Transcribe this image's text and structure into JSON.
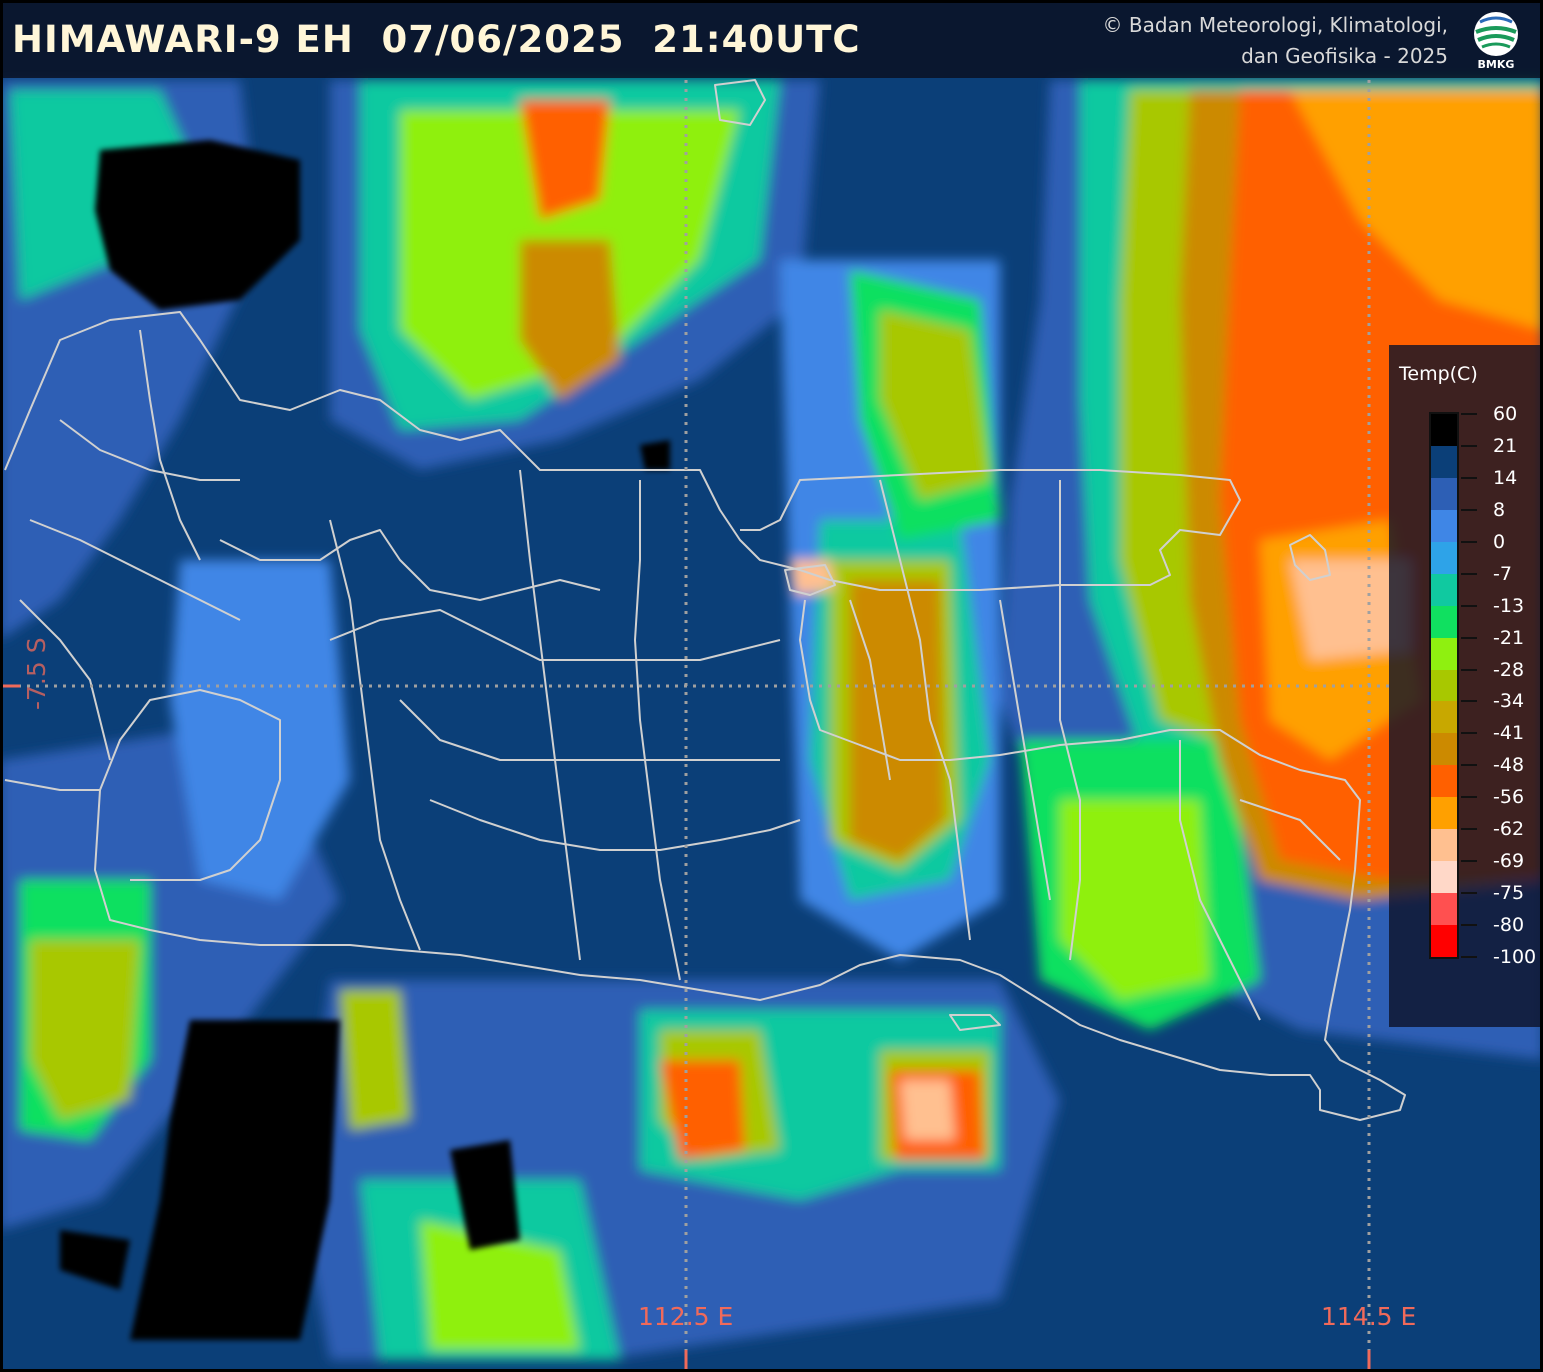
{
  "header": {
    "title": "HIMAWARI-9 EH  07/06/2025  21:40UTC",
    "copyright_line1": "© Badan Meteorologi, Klimatologi,",
    "copyright_line2": "dan Geofisika -  2025",
    "logo_text": "BMKG"
  },
  "legend": {
    "title": "Temp(C)",
    "ticks": [
      "60",
      "21",
      "14",
      "8",
      "0",
      "-7",
      "-13",
      "-21",
      "-28",
      "-34",
      "-41",
      "-48",
      "-56",
      "-62",
      "-69",
      "-75",
      "-80",
      "-100"
    ],
    "colors": [
      "#000000",
      "#0b3f78",
      "#2d5fb5",
      "#3f86e6",
      "#2ea3e8",
      "#10c9a0",
      "#10e060",
      "#8ff010",
      "#a8c800",
      "#c8a800",
      "#cc8a00",
      "#ff6000",
      "#ffa000",
      "#ffc090",
      "#ffd8c8",
      "#ff5050",
      "#ff0000"
    ]
  },
  "grid": {
    "lon_labels": [
      "112.5 E",
      "114.5 E"
    ],
    "lat_label": "-7.5 S"
  },
  "map": {
    "background_color": "#0b3f78",
    "land_black_color": "#000000",
    "border_color": "#d0d0d0",
    "gridline_color": "#a0a0a0"
  }
}
